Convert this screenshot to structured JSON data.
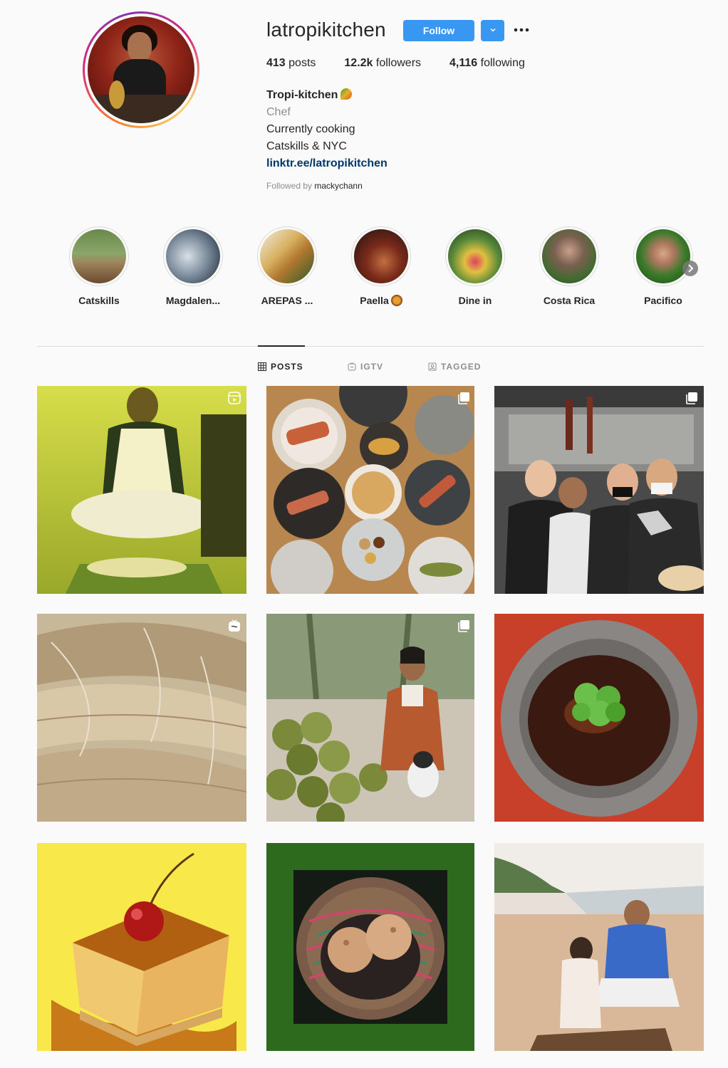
{
  "profile": {
    "username": "latropikitchen",
    "follow_label": "Follow",
    "more_label": "•••",
    "stats": {
      "posts_count": "413",
      "posts_label": " posts",
      "followers_count": "12.2k",
      "followers_label": " followers",
      "following_count": "4,116",
      "following_label": " following"
    },
    "bio": {
      "name": "Tropi-kitchen",
      "category": "Chef",
      "line1": "Currently cooking",
      "line2": "Catskills & NYC",
      "link": "linktr.ee/latropikitchen"
    },
    "followed_by_label": "Followed by ",
    "followed_by_user": "mackychann"
  },
  "highlights": [
    {
      "label": "Catskills"
    },
    {
      "label": "Magdalen..."
    },
    {
      "label": "AREPAS ..."
    },
    {
      "label": "Paella"
    },
    {
      "label": "Dine in"
    },
    {
      "label": "Costa Rica"
    },
    {
      "label": "Pacifico"
    }
  ],
  "tabs": [
    {
      "label": "POSTS",
      "active": true
    },
    {
      "label": "IGTV",
      "active": false
    },
    {
      "label": "TAGGED",
      "active": false
    }
  ],
  "colors": {
    "accent": "#3897f0",
    "link": "#00376b",
    "muted": "#8e8e8e",
    "border": "#dbdbdb"
  },
  "icons": {
    "follow_dropdown": "chevron-down-icon",
    "more": "more-dots-icon",
    "highlights_next": "chevron-right-icon",
    "posts_tab": "grid-icon",
    "igtv_tab": "igtv-icon",
    "tagged_tab": "tagged-icon",
    "reel_badge": "reels-icon",
    "carousel_badge": "carousel-icon",
    "igtv_badge": "igtv-icon"
  }
}
